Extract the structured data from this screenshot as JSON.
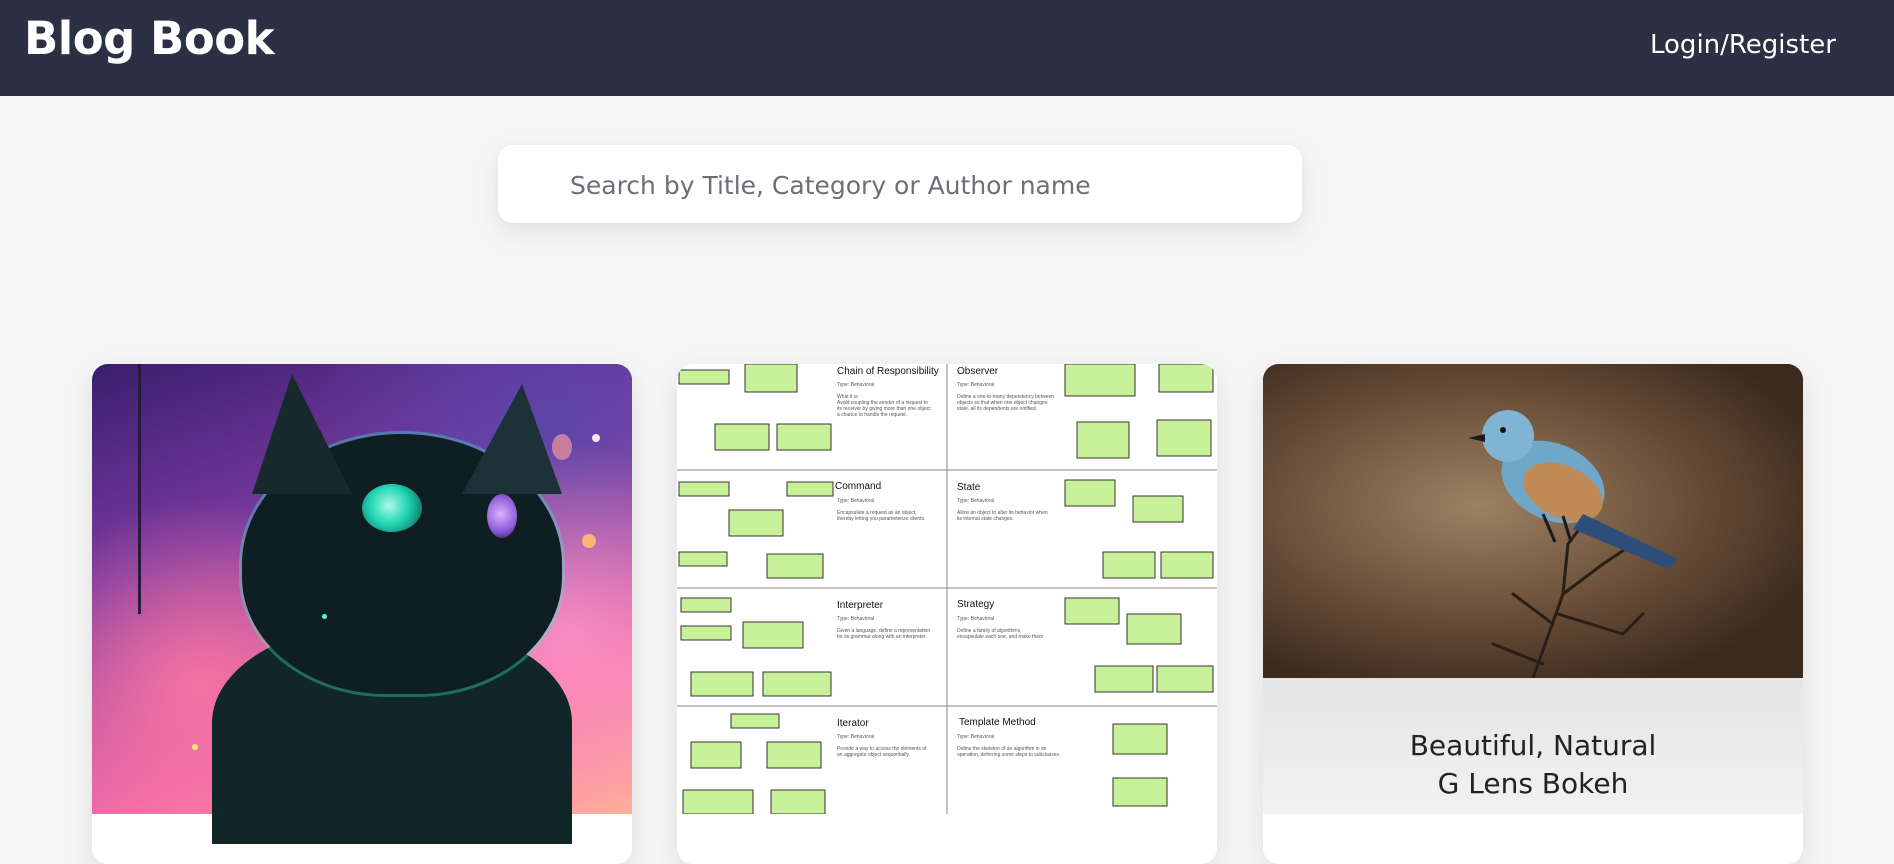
{
  "header": {
    "brand": "Blog Book",
    "login_label": "Login/Register"
  },
  "search": {
    "placeholder": "Search by Title, Category or Author name"
  },
  "cards": [
    {
      "image": "cat-illustration",
      "title": ""
    },
    {
      "image": "uml-design-patterns-sheet",
      "title": "",
      "patterns": [
        "Chain of Responsibility",
        "Observer",
        "Command",
        "State",
        "Interpreter",
        "Strategy",
        "Iterator",
        "Template Method"
      ]
    },
    {
      "image": "bird-on-branch",
      "title": "Beautiful, Natural\nG Lens Bokeh"
    }
  ],
  "colors": {
    "header_bg": "#2b3044",
    "page_bg": "#f6f6f6"
  }
}
